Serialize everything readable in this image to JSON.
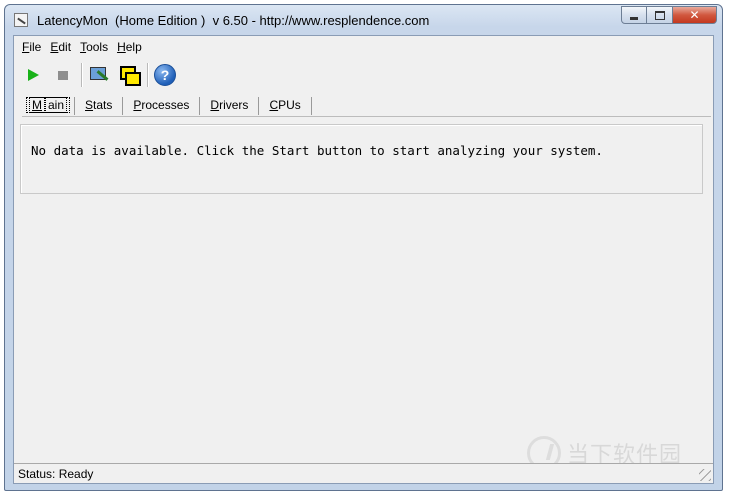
{
  "window": {
    "title": "LatencyMon  (Home Edition )  v 6.50 - http://www.resplendence.com",
    "close_glyph": "✕"
  },
  "menu": [
    {
      "accel": "F",
      "rest": "ile"
    },
    {
      "accel": "E",
      "rest": "dit"
    },
    {
      "accel": "T",
      "rest": "ools"
    },
    {
      "accel": "H",
      "rest": "elp"
    }
  ],
  "toolbar": {
    "icons": [
      "play-icon",
      "stop-icon",
      "monitor-icon",
      "windows-icon",
      "help-icon"
    ],
    "help_glyph": "?",
    "colors": {
      "play": "#19b219",
      "help": "#1f5fb8"
    }
  },
  "tabs": [
    {
      "accel": "M",
      "rest": "ain",
      "active": true
    },
    {
      "accel": "S",
      "rest": "tats",
      "active": false
    },
    {
      "accel": "P",
      "rest": "rocesses",
      "active": false
    },
    {
      "accel": "D",
      "rest": "rivers",
      "active": false
    },
    {
      "accel": "C",
      "rest": "PUs",
      "active": false
    }
  ],
  "main": {
    "message": "No data is available. Click the Start button to start analyzing your system."
  },
  "status": {
    "text": "Status: Ready"
  },
  "watermark": {
    "text": "当下软件园"
  }
}
